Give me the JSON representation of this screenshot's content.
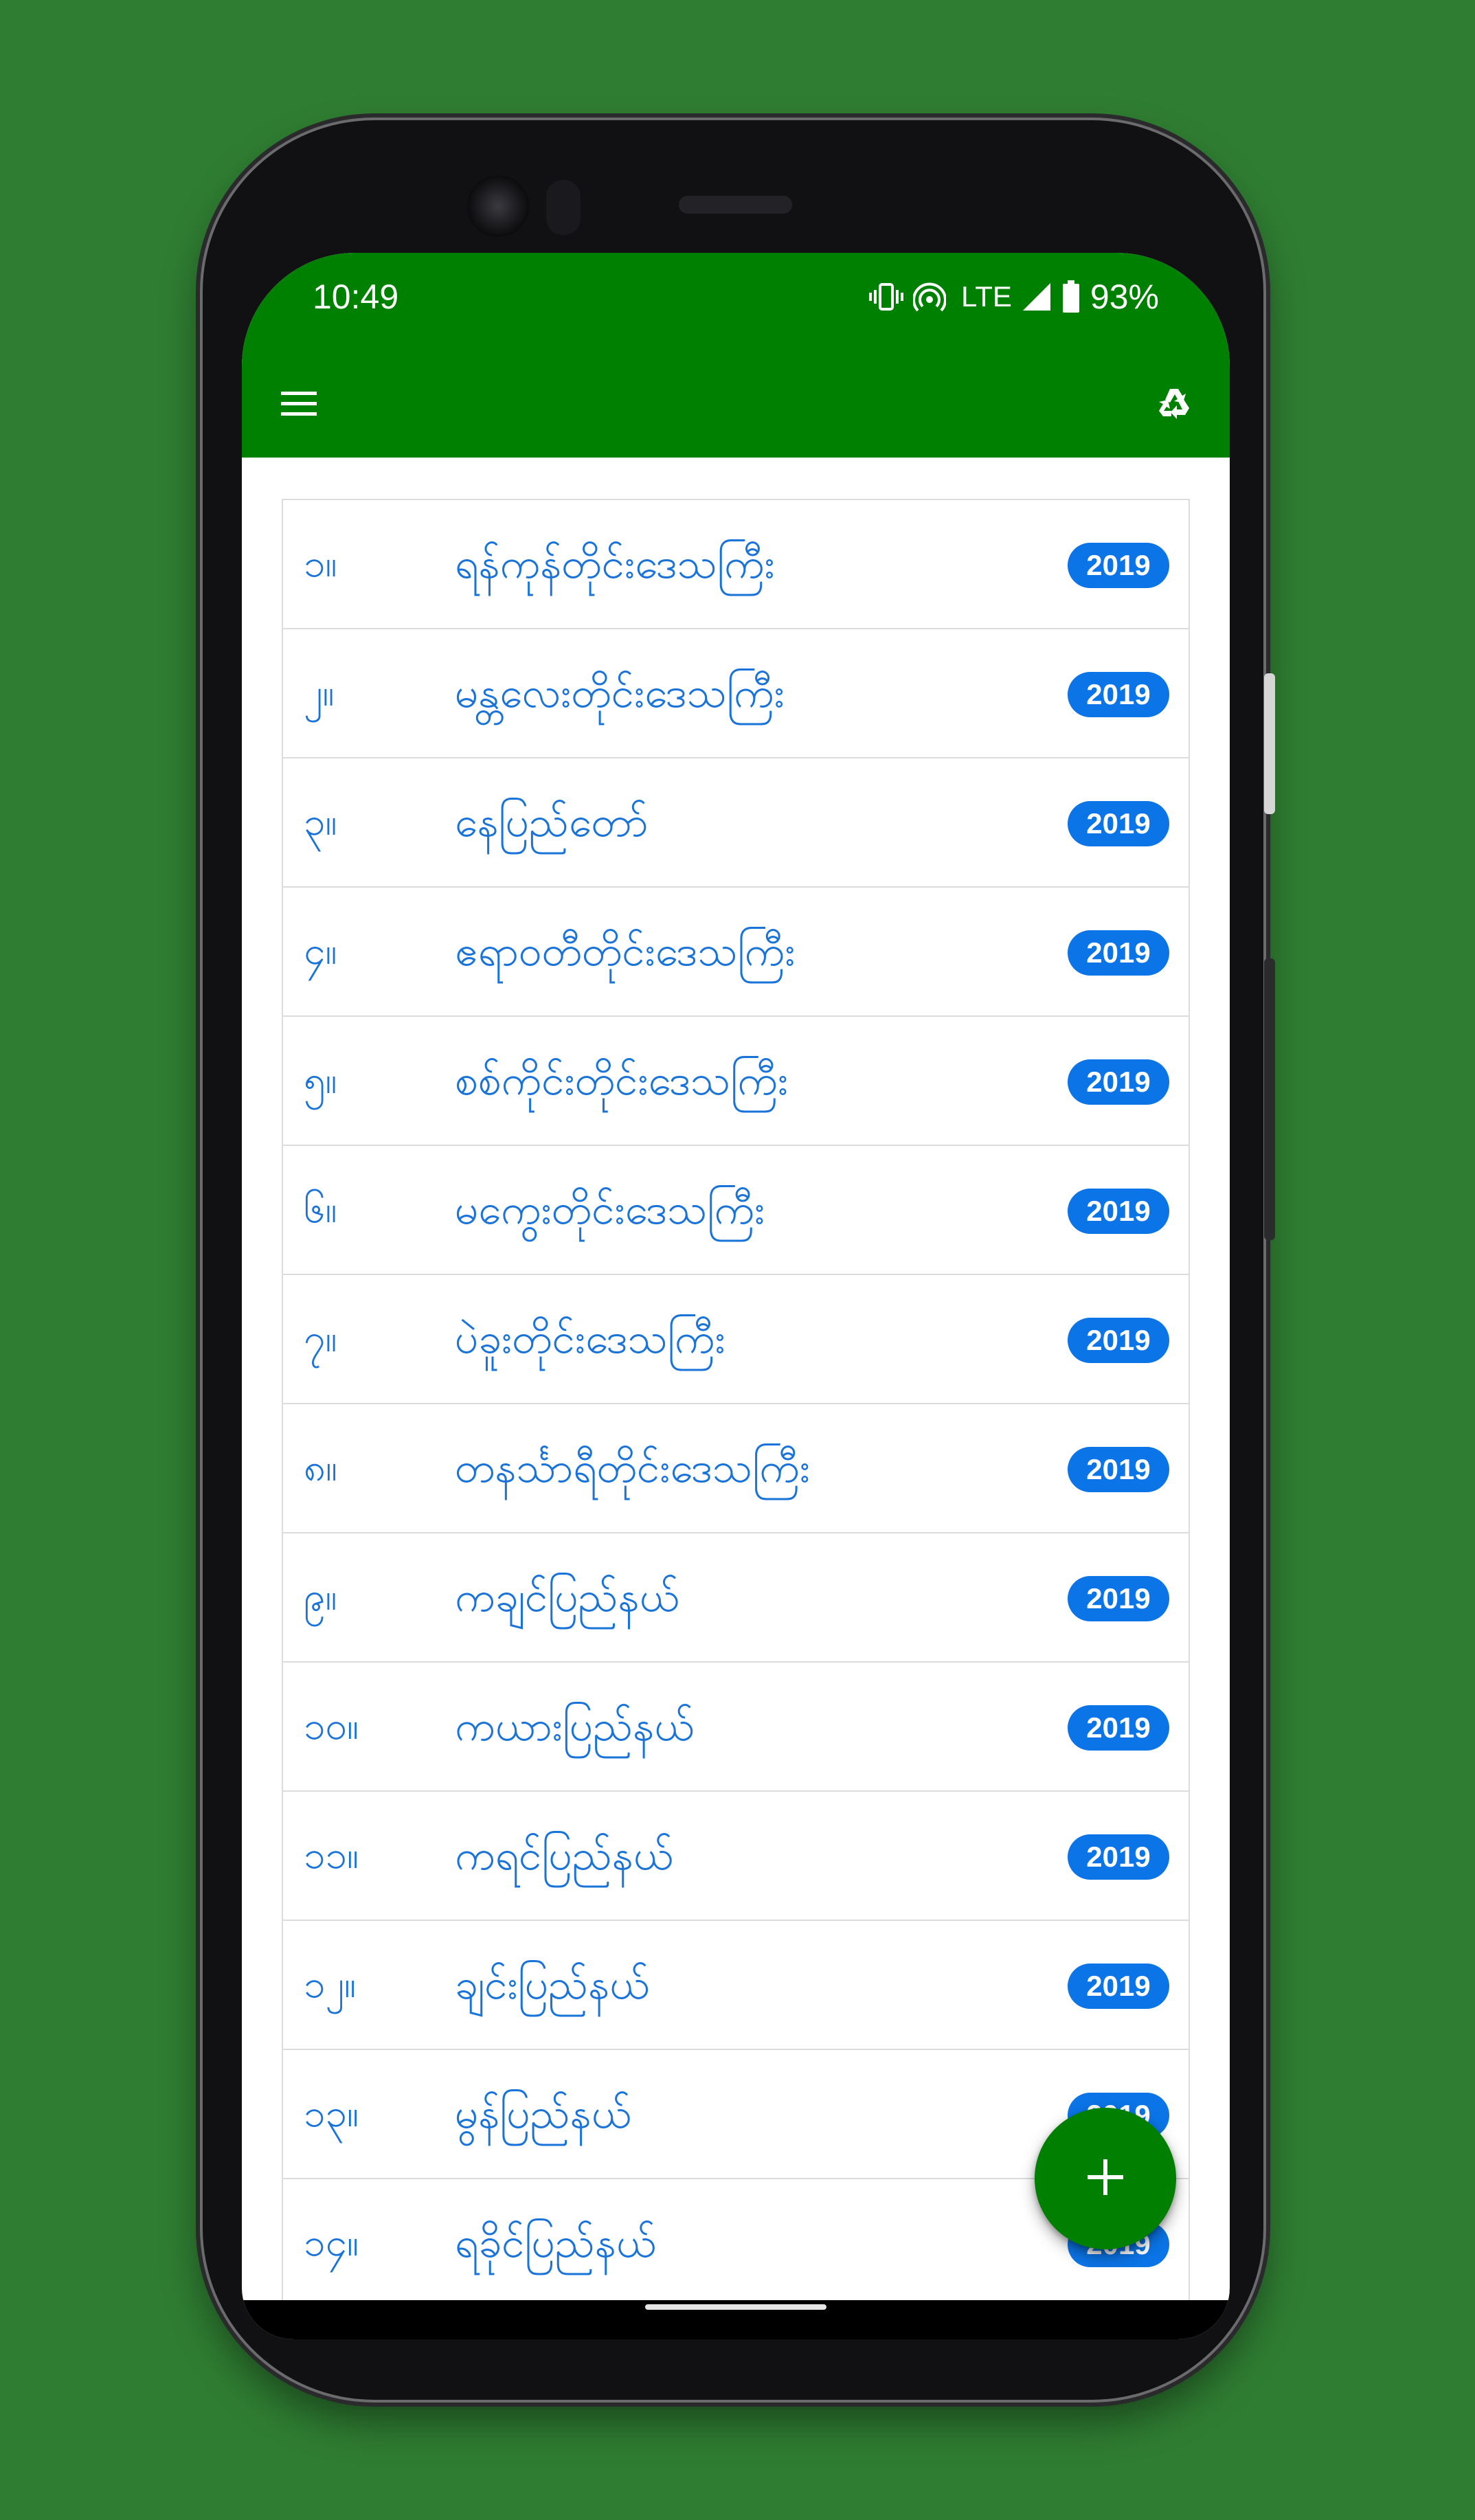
{
  "status_bar": {
    "time": "10:49",
    "network": "LTE",
    "battery": "93%",
    "icons": [
      "vibrate-icon",
      "hotspot-icon",
      "signal-icon",
      "battery-icon"
    ]
  },
  "app_bar": {
    "background_color": "#008000",
    "icons": [
      "menu-icon",
      "recycle-icon"
    ]
  },
  "list": {
    "badge_color": "#0b74e6",
    "text_color": "#1a73d9",
    "items": [
      {
        "number": "၁။",
        "name": "ရန်ကုန်တိုင်းဒေသကြီး",
        "badge": "2019"
      },
      {
        "number": "၂။",
        "name": "မန္တလေးတိုင်းဒေသကြီး",
        "badge": "2019"
      },
      {
        "number": "၃။",
        "name": "နေပြည်တော်",
        "badge": "2019"
      },
      {
        "number": "၄။",
        "name": "ဧရာဝတီတိုင်းဒေသကြီး",
        "badge": "2019"
      },
      {
        "number": "၅။",
        "name": "စစ်ကိုင်းတိုင်းဒေသကြီး",
        "badge": "2019"
      },
      {
        "number": "၆။",
        "name": "မကွေးတိုင်းဒေသကြီး",
        "badge": "2019"
      },
      {
        "number": "၇။",
        "name": "ပဲခူးတိုင်းဒေသကြီး",
        "badge": "2019"
      },
      {
        "number": "၈။",
        "name": "တနင်္သာရီတိုင်းဒေသကြီး",
        "badge": "2019"
      },
      {
        "number": "၉။",
        "name": "ကချင်ပြည်နယ်",
        "badge": "2019"
      },
      {
        "number": "၁၀။",
        "name": "ကယားပြည်နယ်",
        "badge": "2019"
      },
      {
        "number": "၁၁။",
        "name": "ကရင်ပြည်နယ်",
        "badge": "2019"
      },
      {
        "number": "၁၂။",
        "name": "ချင်းပြည်နယ်",
        "badge": "2019"
      },
      {
        "number": "၁၃။",
        "name": "မွန်ပြည်နယ်",
        "badge": "2019"
      },
      {
        "number": "၁၄။",
        "name": "ရခိုင်ပြည်နယ်",
        "badge": "2019"
      }
    ]
  },
  "fab": {
    "icon": "plus-icon",
    "color": "#007f00"
  }
}
